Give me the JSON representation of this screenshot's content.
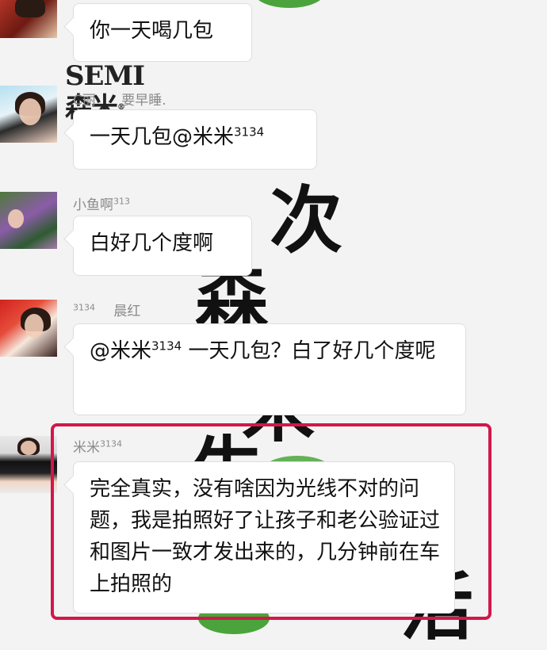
{
  "watermark": {
    "brand": "SEMI森米",
    "registered": "®",
    "chars": [
      "次",
      "森",
      "米",
      "生",
      "活"
    ]
  },
  "messages": [
    {
      "sender": "",
      "text": "你一天喝几包"
    },
    {
      "sender": "C丽      要早睡.",
      "text_pre": "一天几包@米米",
      "text_sup": "3134"
    },
    {
      "sender_main": "小鱼啊",
      "sender_sup": "313",
      "text": "白好几个度啊"
    },
    {
      "sender_sup": "3134",
      "sender_main": "晨红",
      "text_pre": "@米米",
      "text_sup": "3134",
      "text_post": " 一天几包？白了好几个度呢"
    },
    {
      "sender_main": "米米",
      "sender_sup": "3134",
      "text": "完全真实，没有啥因为光线不对的问题，我是拍照好了让孩子和老公验证过和图片一致才发出来的，几分钟前在车上拍照的"
    }
  ],
  "colors": {
    "highlight_border": "#d3164b",
    "bubble_bg": "#ffffff",
    "page_bg": "#f3f3f3",
    "name_color": "#8a8a8a"
  }
}
